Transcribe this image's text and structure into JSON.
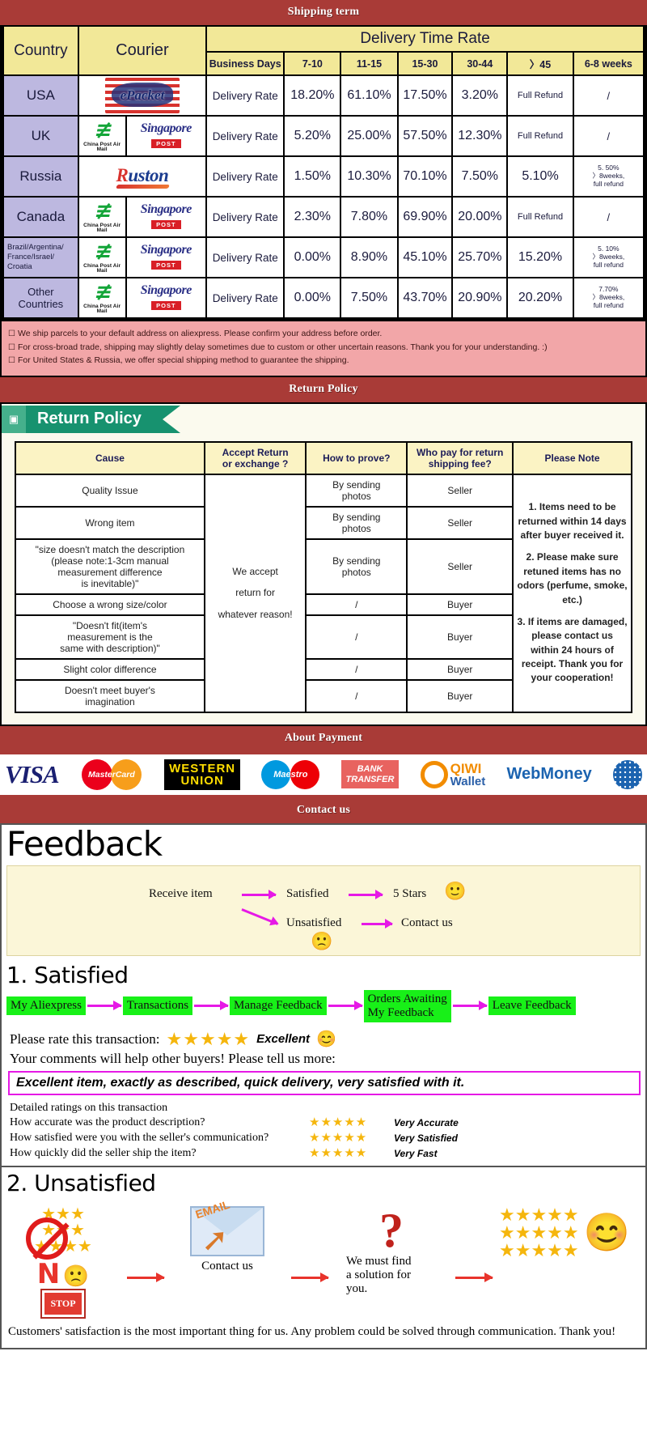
{
  "banners": {
    "shipping": "Shipping term",
    "return": "Return Policy",
    "payment": "About Payment",
    "contact": "Contact us"
  },
  "shipping": {
    "headers": {
      "country": "Country",
      "courier": "Courier",
      "delivery_time_rate": "Delivery Time Rate",
      "business_days": "Business Days",
      "ranges": [
        "7-10",
        "11-15",
        "15-30",
        "30-44",
        "〉45",
        "6-8 weeks"
      ]
    },
    "rate_label": "Delivery Rate",
    "rows": [
      {
        "country": "USA",
        "couriers": [
          "epacket"
        ],
        "values": [
          "18.20%",
          "61.10%",
          "17.50%",
          "3.20%",
          "Full Refund",
          "/"
        ]
      },
      {
        "country": "UK",
        "couriers": [
          "china-post-air-mail",
          "singapore-post"
        ],
        "values": [
          "5.20%",
          "25.00%",
          "57.50%",
          "12.30%",
          "Full Refund",
          "/"
        ]
      },
      {
        "country": "Russia",
        "couriers": [
          "ruston"
        ],
        "values": [
          "1.50%",
          "10.30%",
          "70.10%",
          "7.50%",
          "5.10%",
          "5. 50%\n〉8weeks,\nfull refund"
        ]
      },
      {
        "country": "Canada",
        "couriers": [
          "china-post-air-mail",
          "singapore-post"
        ],
        "values": [
          "2.30%",
          "7.80%",
          "69.90%",
          "20.00%",
          "Full Refund",
          "/"
        ]
      },
      {
        "country": "Brazil/Argentina/\nFrance/Israel/\nCroatia",
        "couriers": [
          "china-post-air-mail",
          "singapore-post"
        ],
        "values": [
          "0.00%",
          "8.90%",
          "45.10%",
          "25.70%",
          "15.20%",
          "5. 10%\n〉8weeks,\nfull refund"
        ]
      },
      {
        "country": "Other Countries",
        "couriers": [
          "china-post-air-mail",
          "singapore-post"
        ],
        "values": [
          "0.00%",
          "7.50%",
          "43.70%",
          "20.90%",
          "20.20%",
          "7.70%\n〉8weeks,\nfull refund"
        ]
      }
    ],
    "notes": [
      "We ship parcels to your default address on aliexpress. Please confirm your address before order.",
      "For cross-broad trade, shipping may slightly delay sometimes due to custom or other uncertain reasons. Thank you for your understanding. :)",
      "For United States & Russia, we offer special shipping method to guarantee the shipping."
    ]
  },
  "return_policy": {
    "tab_label": "Return Policy",
    "headers": [
      "Cause",
      "Accept Return\nor exchange ?",
      "How to prove?",
      "Who pay for return\nshipping fee?",
      "Please Note"
    ],
    "accept_text": [
      "We accept",
      "return for",
      "whatever reason!"
    ],
    "rows": [
      {
        "cause": "Quality Issue",
        "prove": "By sending\nphotos",
        "who_pays": "Seller"
      },
      {
        "cause": "Wrong item",
        "prove": "By sending\nphotos",
        "who_pays": "Seller"
      },
      {
        "cause": "\"size doesn't match the description\n(please note:1-3cm manual\nmeasurement difference\nis inevitable)\"",
        "prove": "By sending\nphotos",
        "who_pays": "Seller"
      },
      {
        "cause": "Choose a wrong size/color",
        "prove": "/",
        "who_pays": "Buyer"
      },
      {
        "cause": "\"Doesn't fit(item's\nmeasurement is the\nsame with description)\"",
        "prove": "/",
        "who_pays": "Buyer"
      },
      {
        "cause": "Slight color difference",
        "prove": "/",
        "who_pays": "Buyer"
      },
      {
        "cause": "Doesn't meet buyer's\nimagination",
        "prove": "/",
        "who_pays": "Buyer"
      }
    ],
    "notes": [
      "1. Items need to be returned within 14 days after buyer received it.",
      "2. Please make sure retuned items has no odors (perfume, smoke, etc.)",
      "3. If items are damaged, please contact us within 24 hours of receipt. Thank you for your cooperation!"
    ]
  },
  "payment": {
    "methods": [
      {
        "name": "visa",
        "label": "VISA"
      },
      {
        "name": "mastercard",
        "label": "MasterCard"
      },
      {
        "name": "western-union",
        "label_top": "WESTERN",
        "label_bottom": "UNION"
      },
      {
        "name": "maestro",
        "label": "Maestro"
      },
      {
        "name": "bank-transfer",
        "label_top": "BANK",
        "label_bottom": "TRANSFER"
      },
      {
        "name": "qiwi-wallet",
        "label_top": "QIWI",
        "label_bottom": "Wallet"
      },
      {
        "name": "webmoney",
        "label": "WebMoney"
      }
    ]
  },
  "feedback": {
    "title": "Feedback",
    "flow": {
      "receive_item": "Receive item",
      "satisfied": "Satisfied",
      "five_stars": "5 Stars",
      "unsatisfied": "Unsatisfied",
      "contact_us": "Contact us",
      "happy_emoji": "🙂",
      "sad_emoji": "🙁"
    },
    "satisfied": {
      "heading": "1. Satisfied",
      "chain": [
        "My Aliexpress",
        "Transactions",
        "Manage Feedback",
        "Orders Awaiting\nMy Feedback",
        "Leave Feedback"
      ],
      "rate_prompt": "Please rate this transaction:",
      "stars": "★★★★★",
      "rating_word": "Excellent",
      "smiley": "😊",
      "comments_prompt": "Your comments will help other buyers! Please tell us more:",
      "comment_text": "Excellent item, exactly as described, quick delivery, very satisfied with it.",
      "detail_head": "Detailed ratings on this transaction",
      "details": [
        {
          "question": "How accurate was the product description?",
          "stars": "★★★★★",
          "value": "Very Accurate"
        },
        {
          "question": "How satisfied were you with the seller's communication?",
          "stars": "★★★★★",
          "value": "Very Satisfied"
        },
        {
          "question": "How quickly did the seller ship the item?",
          "stars": "★★★★★",
          "value": "Very Fast"
        }
      ]
    },
    "unsatisfied": {
      "heading": "2. Unsatisfied",
      "no_label": "N",
      "stop_label": "STOP",
      "email_label": "EMAIL",
      "contact_caption": "Contact us",
      "solution_caption": "We must find\na solution for\nyou.",
      "good_stars": "★★★★★",
      "closing": "Customers' satisfaction is the most important thing for us. Any problem could be solved through communication. Thank you!"
    }
  }
}
